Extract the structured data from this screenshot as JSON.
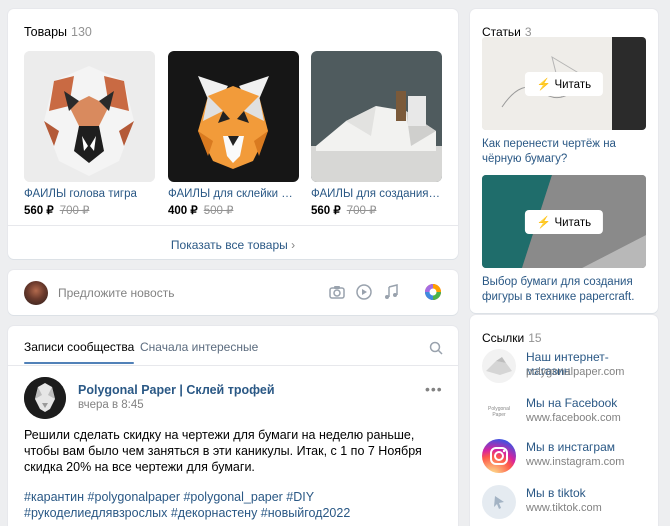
{
  "goods": {
    "title": "Товары",
    "count": "130",
    "items": [
      {
        "name": "ФАЙЛЫ голова тигра",
        "price": "560 ₽",
        "old_price": "700 ₽"
      },
      {
        "name": "ФАЙЛЫ для склейки маски",
        "price": "400 ₽",
        "old_price": "500 ₽"
      },
      {
        "name": "ФАЙЛЫ для создания головы",
        "price": "560 ₽",
        "old_price": "700 ₽"
      }
    ],
    "show_all": "Показать все товары"
  },
  "suggest": {
    "placeholder": "Предложите новость",
    "icons": [
      "camera-icon",
      "video-icon",
      "music-icon",
      "color-wheel-icon"
    ]
  },
  "wall": {
    "tabs": [
      "Записи сообщества",
      "Сначала интересные"
    ],
    "post": {
      "author": "Polygonal Paper | Склей трофей",
      "date": "вчера в 8:45",
      "more": "•••",
      "text": "Решили сделать скидку на чертежи для бумаги на неделю раньше, чтобы вам было чем заняться в эти каникулы. Итак, с 1 по 7 Ноября скидка 20% на все чертежи для бумаги.",
      "tags": "#карантин #polygonalpaper #polygonal_paper #DIY #рукоделиедлявзрослых #декорнастену #новыйгод2022"
    }
  },
  "articles": {
    "title": "Статьи",
    "count": "3",
    "read_label": "Читать",
    "items": [
      {
        "title": "Как перенести чертёж на чёрную бумагу?"
      },
      {
        "title": "Выбор бумаги для создания фигуры в технике papercraft."
      }
    ]
  },
  "links": {
    "title": "Ссылки",
    "count": "15",
    "items": [
      {
        "name": "Наш интернет-магазин",
        "url": "polygonalpaper.com",
        "logo_text": ""
      },
      {
        "name": "Мы на Facebook",
        "url": "www.facebook.com",
        "logo_text": "Polygonal Paper"
      },
      {
        "name": "Мы в инстаграм",
        "url": "www.instagram.com",
        "logo_text": ""
      },
      {
        "name": "Мы в tiktok",
        "url": "www.tiktok.com",
        "logo_text": ""
      }
    ]
  },
  "colors": {
    "link": "#2a5885",
    "accent": "#5181b8",
    "background": "#edeef0"
  }
}
